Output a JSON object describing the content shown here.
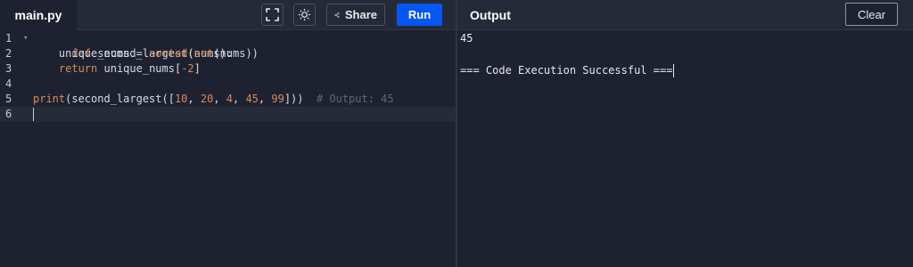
{
  "editor": {
    "file_tab": "main.py",
    "line_numbers": [
      "1",
      "2",
      "3",
      "4",
      "5",
      "6"
    ],
    "code": {
      "l1_kw": "def",
      "l1_rest": " second_largest(nums):",
      "l2_indent": "    unique_nums = ",
      "l2_fn": "sorted",
      "l2_paren": "(",
      "l2_set": "set",
      "l2_end": "(nums))",
      "l3_indent": "    ",
      "l3_kw": "return",
      "l3_rest": " unique_nums[",
      "l3_num": "-2",
      "l3_close": "]",
      "l5_fn": "print",
      "l5_a": "(second_largest([",
      "l5_n1": "10",
      "l5_c1": ", ",
      "l5_n2": "20",
      "l5_c2": ", ",
      "l5_n3": "4",
      "l5_c3": ", ",
      "l5_n4": "45",
      "l5_c4": ", ",
      "l5_n5": "99",
      "l5_end": "]))  ",
      "l5_comment": "# Output: 45"
    }
  },
  "toolbar": {
    "share_label": "Share",
    "run_label": "Run"
  },
  "output": {
    "title": "Output",
    "clear_label": "Clear",
    "lines": [
      "45",
      "",
      "=== Code Execution Successful ==="
    ]
  },
  "colors": {
    "run_button": "#0556f3",
    "keyword": "#d58a5a",
    "comment": "#5f6577"
  }
}
